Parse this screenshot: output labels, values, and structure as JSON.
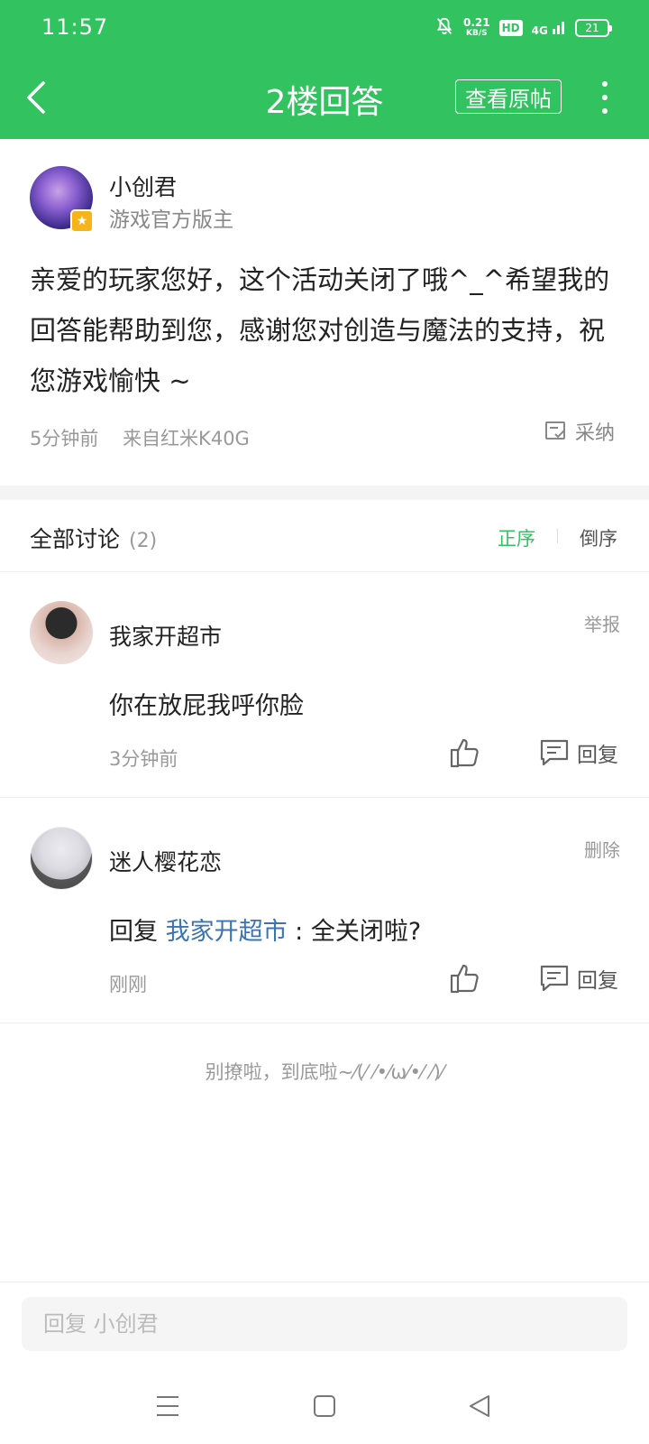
{
  "status_bar": {
    "time": "11:57",
    "net_speed_value": "0.21",
    "net_speed_unit": "KB/S",
    "hd": "HD",
    "signal": "4G",
    "battery": "21"
  },
  "nav": {
    "title": "2楼回答",
    "view_original": "查看原帖"
  },
  "answer": {
    "author_name": "小创君",
    "author_role": "游戏官方版主",
    "body": "亲爱的玩家您好，这个活动关闭了哦^_^希望我的回答能帮助到您，感谢您对创造与魔法的支持，祝您游戏愉快 ~",
    "time": "5分钟前",
    "device": "来自红米K40G",
    "adopt_label": "采纳"
  },
  "discussion": {
    "title": "全部讨论",
    "count": "(2)",
    "sort_asc": "正序",
    "sort_desc": "倒序"
  },
  "comments": [
    {
      "name": "我家开超市",
      "action": "举报",
      "body": "你在放屁我呼你脸",
      "time": "3分钟前",
      "reply_label": "回复"
    },
    {
      "name": "迷人樱花恋",
      "action": "删除",
      "reply_prefix": "回复",
      "mention": "我家开超市",
      "body_suffix": " : 全关闭啦?",
      "time": "刚刚",
      "reply_label": "回复"
    }
  ],
  "end_note": "别撩啦，到底啦~⁄(⁄ ⁄•⁄ω⁄•⁄ ⁄)⁄",
  "bottom": {
    "placeholder": "回复 小创君"
  },
  "colors": {
    "brand_green": "#32c360",
    "mention_blue": "#3c74b3"
  }
}
